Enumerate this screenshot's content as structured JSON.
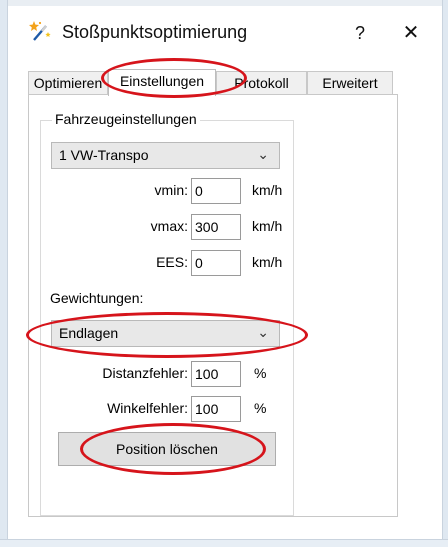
{
  "window": {
    "title": "Stoßpunktsoptimierung",
    "help": "?",
    "close": "✕"
  },
  "tabs": [
    {
      "label": "Optimieren",
      "active": false
    },
    {
      "label": "Einstellungen",
      "active": true
    },
    {
      "label": "Protokoll",
      "active": false
    },
    {
      "label": "Erweitert",
      "active": false
    }
  ],
  "vehicle": {
    "group_label": "Fahrzeugeinstellungen",
    "selected": "1  VW-Transpo",
    "fields": [
      {
        "label": "vmin:",
        "value": "0",
        "unit": "km/h"
      },
      {
        "label": "vmax:",
        "value": "300",
        "unit": "km/h"
      },
      {
        "label": "EES:",
        "value": "0",
        "unit": "km/h"
      }
    ]
  },
  "weighting": {
    "label": "Gewichtungen:",
    "selected": "Endlagen",
    "fields": [
      {
        "label": "Distanzfehler:",
        "value": "100",
        "unit": "%"
      },
      {
        "label": "Winkelfehler:",
        "value": "100",
        "unit": "%"
      }
    ]
  },
  "actions": {
    "clear_position": "Position löschen"
  },
  "annotation_color": "#d6141b",
  "icons": {
    "app": "magic-wand-icon",
    "dropdown": "chevron-down-icon"
  }
}
